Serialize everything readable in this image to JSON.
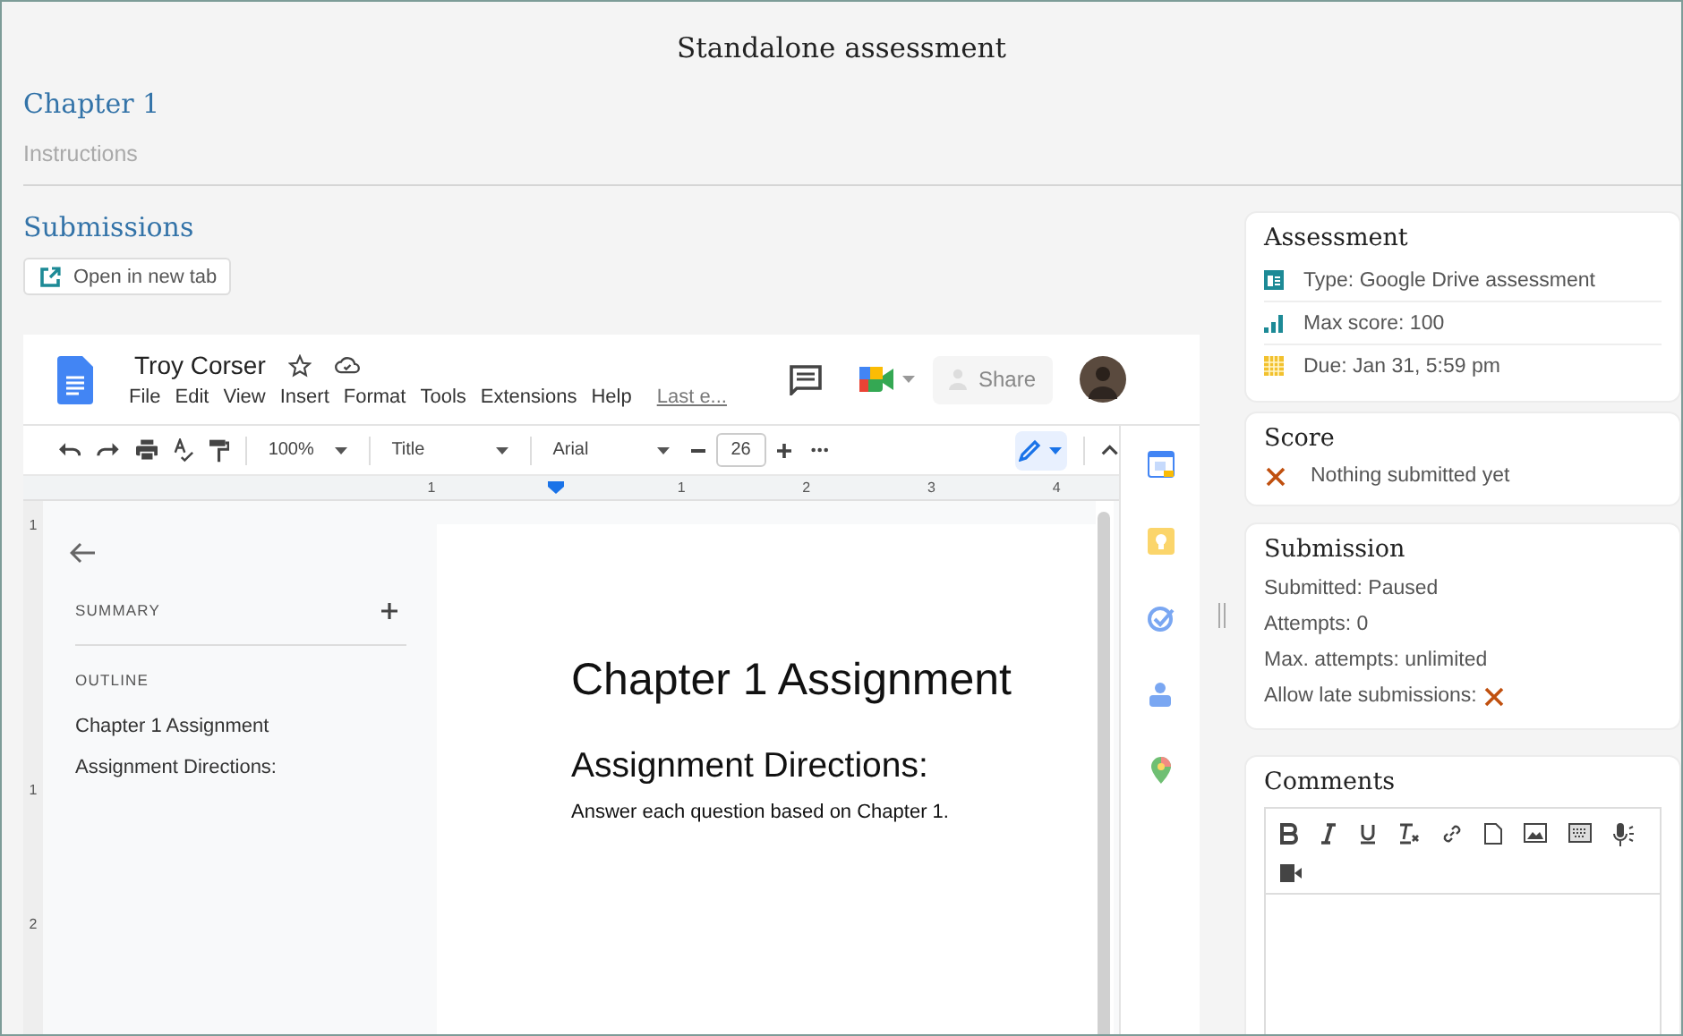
{
  "page_title": "Standalone assessment",
  "chapter": "Chapter 1",
  "instructions_label": "Instructions",
  "submissions": {
    "heading": "Submissions",
    "open_button": "Open in new tab"
  },
  "doc": {
    "title": "Troy Corser",
    "menu": [
      "File",
      "Edit",
      "View",
      "Insert",
      "Format",
      "Tools",
      "Extensions",
      "Help"
    ],
    "last_edit": "Last e...",
    "share": "Share",
    "toolbar": {
      "zoom": "100%",
      "style": "Title",
      "font": "Arial",
      "font_size": "26"
    },
    "ruler_labels": [
      "1",
      "1",
      "2",
      "3",
      "4"
    ],
    "vertical_ruler_labels": [
      "1",
      "1",
      "2"
    ],
    "outline": {
      "summary_label": "SUMMARY",
      "outline_label": "OUTLINE",
      "items": [
        "Chapter 1 Assignment",
        "Assignment Directions:"
      ]
    },
    "page": {
      "title": "Chapter 1 Assignment",
      "heading": "Assignment Directions:",
      "body": "Answer each question based on Chapter 1."
    }
  },
  "assessment": {
    "heading": "Assessment",
    "rows": [
      {
        "kind": "type",
        "text": "Type: Google Drive assessment"
      },
      {
        "kind": "score",
        "text": "Max score: 100"
      },
      {
        "kind": "due",
        "text": "Due: Jan 31, 5:59 pm"
      }
    ]
  },
  "score": {
    "heading": "Score",
    "submitted": false,
    "text": "Nothing submitted yet"
  },
  "submission": {
    "heading": "Submission",
    "lines": [
      "Submitted: Paused",
      "Attempts: 0",
      "Max. attempts: unlimited"
    ],
    "late": {
      "label": "Allow late submissions:",
      "allowed": false
    }
  },
  "comments": {
    "heading": "Comments"
  }
}
